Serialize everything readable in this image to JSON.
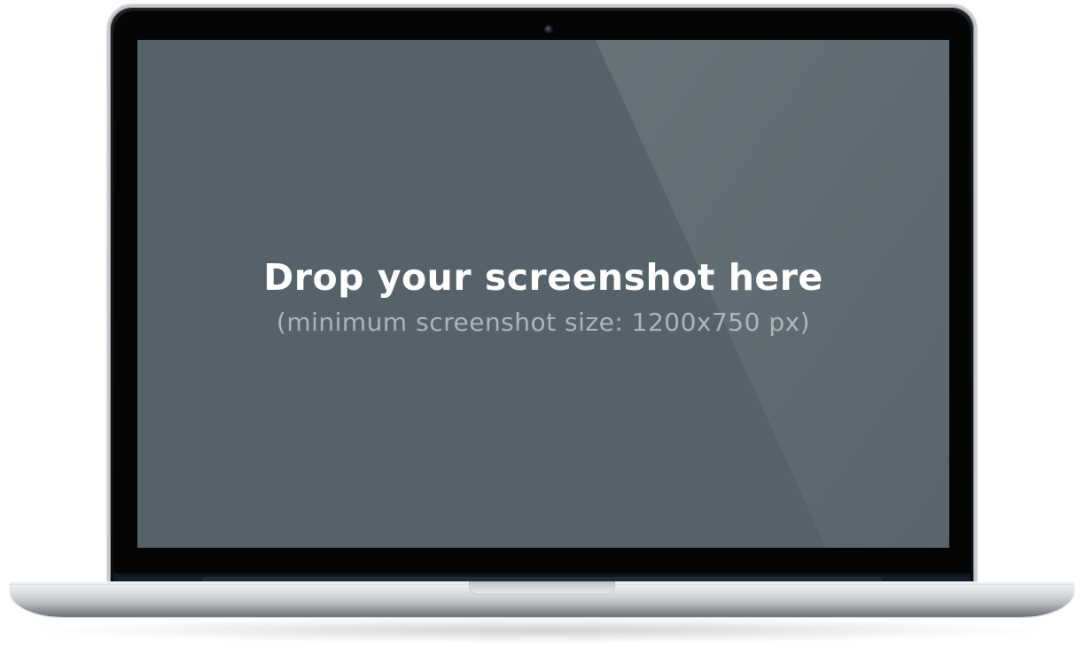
{
  "screen": {
    "title": "Drop your screenshot here",
    "subtitle": "(minimum screenshot size: 1200x750 px)",
    "background_color": "#56626a"
  },
  "device": {
    "icons": {
      "camera": "camera-icon"
    },
    "colors": {
      "bezel": "#050506",
      "body_silver": "#d2d5d8"
    }
  }
}
